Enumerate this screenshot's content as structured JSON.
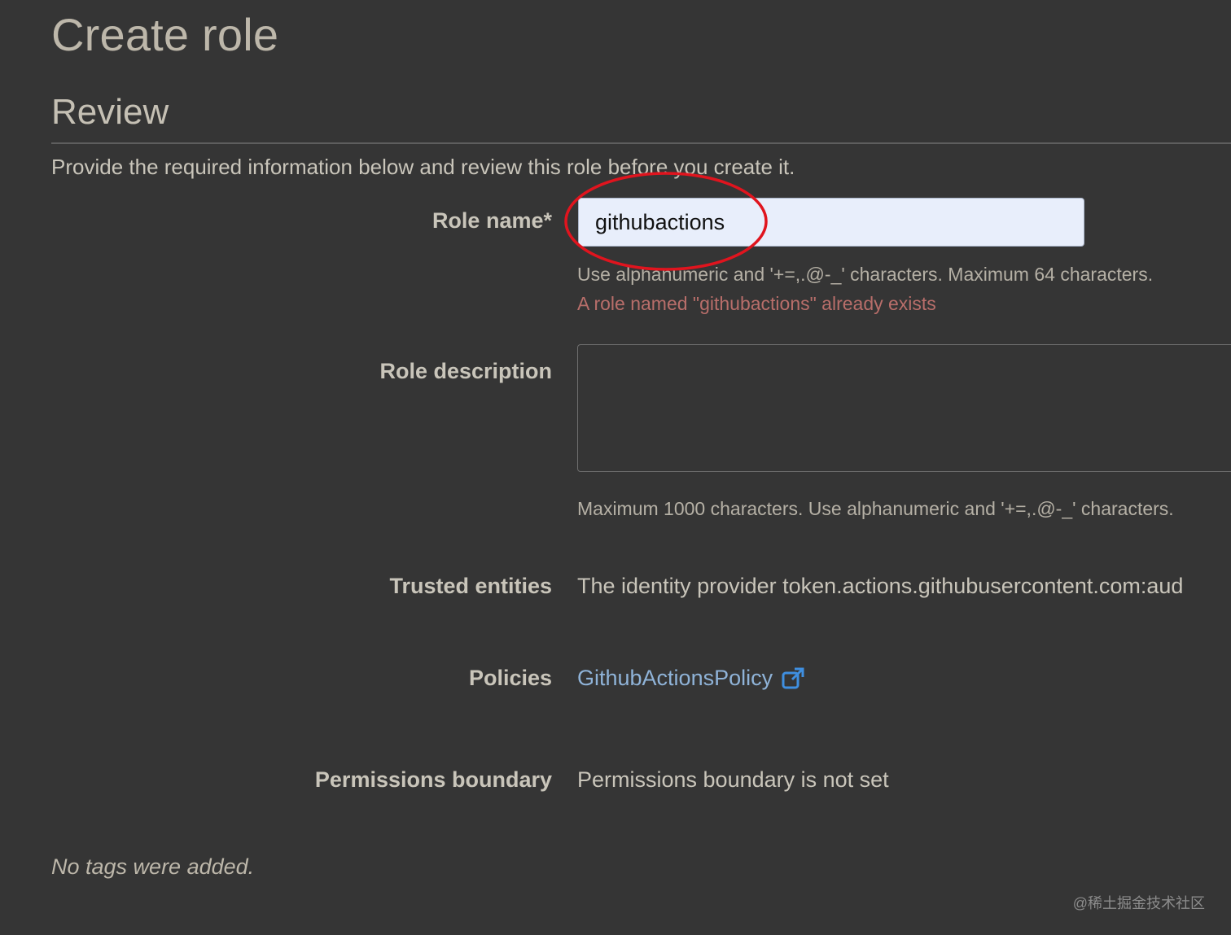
{
  "page": {
    "title": "Create role",
    "subtitle": "Review",
    "intro": "Provide the required information below and review this role before you create it."
  },
  "role_name": {
    "label": "Role name*",
    "value": "githubactions",
    "hint": "Use alphanumeric and '+=,.@-_' characters. Maximum 64 characters.",
    "error": "A role named \"githubactions\" already exists"
  },
  "role_description": {
    "label": "Role description",
    "value": "",
    "hint": "Maximum 1000 characters. Use alphanumeric and '+=,.@-_' characters."
  },
  "trusted_entities": {
    "label": "Trusted entities",
    "value": "The identity provider token.actions.githubusercontent.com:aud"
  },
  "policies": {
    "label": "Policies",
    "link_text": "GithubActionsPolicy",
    "icon": "external-link-icon"
  },
  "permissions_boundary": {
    "label": "Permissions boundary",
    "value": "Permissions boundary is not set"
  },
  "tags": {
    "message": "No tags were added."
  },
  "watermark": "@稀土掘金技术社区",
  "colors": {
    "background": "#353535",
    "input_bg": "#e8eefb",
    "error": "#b86e6a",
    "link": "#8fb3d8",
    "annotation_circle": "#e0141e"
  }
}
